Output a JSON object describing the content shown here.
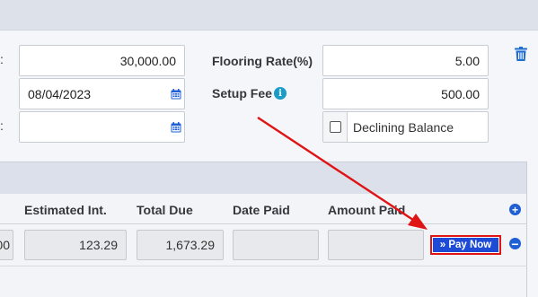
{
  "form": {
    "amount_value": "30,000.00",
    "date_value": "08/04/2023",
    "second_date_value": "",
    "flooring_rate_label": "Flooring Rate(%)",
    "flooring_rate_value": "5.00",
    "setup_fee_label": "Setup Fee",
    "setup_fee_value": "500.00",
    "declining_balance_label": "Declining Balance",
    "declining_balance_checked": false,
    "colon_1": ":",
    "colon_2": ":"
  },
  "table": {
    "headers": [
      "Estimated Int.",
      "Total Due",
      "Date Paid",
      "Amount Paid"
    ],
    "row": {
      "partial_value": "00",
      "estimated_int": "123.29",
      "total_due": "1,673.29",
      "date_paid": "",
      "amount_paid": "",
      "pay_now_label": "»  Pay Now"
    }
  },
  "colors": {
    "accent_blue": "#1f5fd6",
    "pay_button": "#1e4bd6",
    "annotation_red": "#e01414",
    "info_teal": "#1a9cc8"
  },
  "icons": {
    "calendar": "calendar-icon",
    "info": "info-icon",
    "trash": "trash-icon",
    "add": "plus-circle-icon",
    "remove": "minus-circle-icon"
  }
}
